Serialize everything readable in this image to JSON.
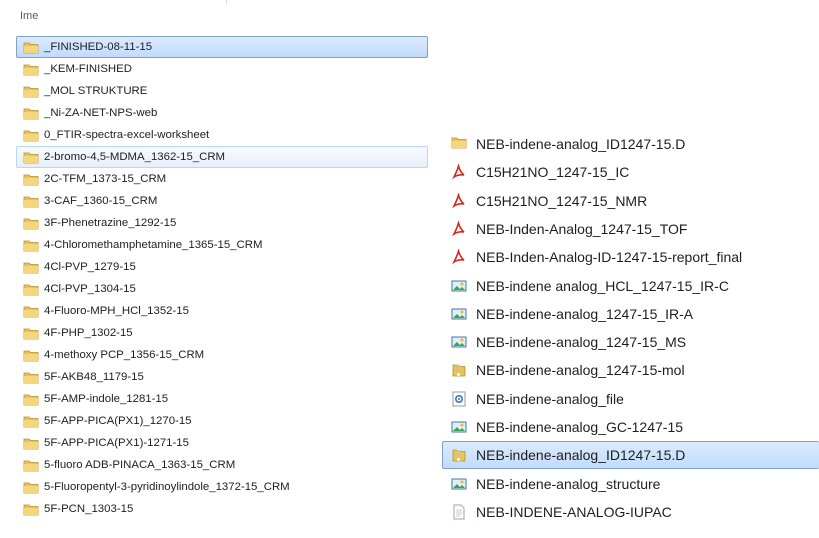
{
  "header": {
    "name_column": "Ime"
  },
  "left_list": [
    {
      "label": "_FINISHED-08-11-15",
      "icon": "folder-icon",
      "state": "selected"
    },
    {
      "label": "_KEM-FINISHED",
      "icon": "folder-icon"
    },
    {
      "label": "_MOL STRUKTURE",
      "icon": "folder-icon"
    },
    {
      "label": "_Ni-ZA-NET-NPS-web",
      "icon": "folder-icon"
    },
    {
      "label": "0_FTIR-spectra-excel-worksheet",
      "icon": "folder-icon"
    },
    {
      "label": "2-bromo-4,5-MDMA_1362-15_CRM",
      "icon": "folder-icon",
      "state": "hot"
    },
    {
      "label": "2C-TFM_1373-15_CRM",
      "icon": "folder-icon"
    },
    {
      "label": "3-CAF_1360-15_CRM",
      "icon": "folder-icon"
    },
    {
      "label": "3F-Phenetrazine_1292-15",
      "icon": "folder-icon"
    },
    {
      "label": "4-Chloromethamphetamine_1365-15_CRM",
      "icon": "folder-icon"
    },
    {
      "label": "4Cl-PVP_1279-15",
      "icon": "folder-icon"
    },
    {
      "label": "4Cl-PVP_1304-15",
      "icon": "folder-icon"
    },
    {
      "label": "4-Fluoro-MPH_HCl_1352-15",
      "icon": "folder-icon"
    },
    {
      "label": "4F-PHP_1302-15",
      "icon": "folder-icon"
    },
    {
      "label": "4-methoxy PCP_1356-15_CRM",
      "icon": "folder-icon"
    },
    {
      "label": "5F-AKB48_1179-15",
      "icon": "folder-icon"
    },
    {
      "label": "5F-AMP-indole_1281-15",
      "icon": "folder-icon"
    },
    {
      "label": "5F-APP-PICA(PX1)_1270-15",
      "icon": "folder-icon"
    },
    {
      "label": "5F-APP-PICA(PX1)-1271-15",
      "icon": "folder-icon"
    },
    {
      "label": "5-fluoro ADB-PINACA_1363-15_CRM",
      "icon": "folder-icon"
    },
    {
      "label": "5-Fluoropentyl-3-pyridinoylindole_1372-15_CRM",
      "icon": "folder-icon"
    },
    {
      "label": "5F-PCN_1303-15",
      "icon": "folder-icon"
    }
  ],
  "right_list": [
    {
      "label": "NEB-indene-analog_ID1247-15.D",
      "icon": "folder-icon"
    },
    {
      "label": "C15H21NO_1247-15_IC",
      "icon": "pdf-icon"
    },
    {
      "label": "C15H21NO_1247-15_NMR",
      "icon": "pdf-icon"
    },
    {
      "label": "NEB-Inden-Analog_1247-15_TOF",
      "icon": "pdf-icon"
    },
    {
      "label": "NEB-Inden-Analog-ID-1247-15-report_final",
      "icon": "pdf-icon"
    },
    {
      "label": "NEB-indene analog_HCL_1247-15_IR-C",
      "icon": "image-icon"
    },
    {
      "label": "NEB-indene-analog_1247-15_IR-A",
      "icon": "image-icon"
    },
    {
      "label": "NEB-indene-analog_1247-15_MS",
      "icon": "image-icon"
    },
    {
      "label": "NEB-indene-analog_1247-15-mol",
      "icon": "folder-zip-icon"
    },
    {
      "label": "NEB-indene-analog_file",
      "icon": "settings-file-icon"
    },
    {
      "label": "NEB-indene-analog_GC-1247-15",
      "icon": "image-icon"
    },
    {
      "label": "NEB-indene-analog_ID1247-15.D",
      "icon": "folder-zip-icon",
      "state": "selected"
    },
    {
      "label": "NEB-indene-analog_structure",
      "icon": "image-icon"
    },
    {
      "label": "NEB-INDENE-ANALOG-IUPAC",
      "icon": "text-file-icon"
    }
  ],
  "colors": {
    "selection_fill": "#c8defb",
    "selection_border": "#7da2ce",
    "hover_border": "#b8d6fb",
    "folder": "#e8c35a",
    "pdf": "#d42a1e"
  }
}
